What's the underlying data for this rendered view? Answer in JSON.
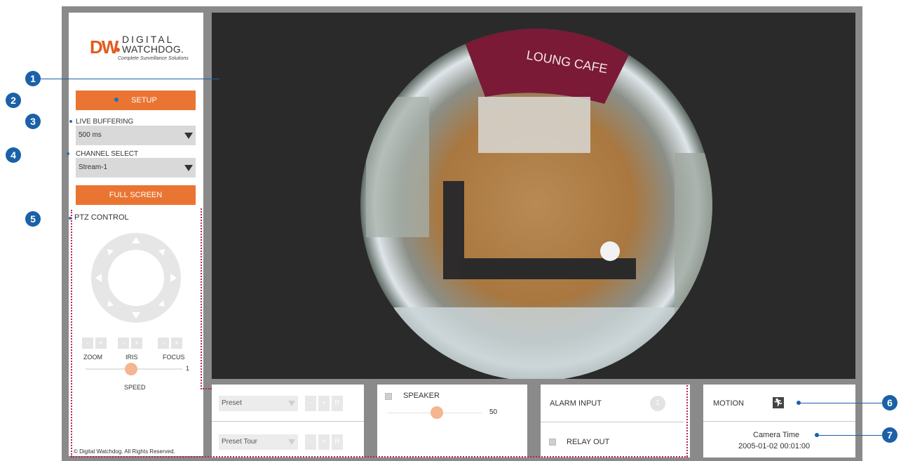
{
  "brand": {
    "logo_mark": "DW",
    "name_line1": "DIGITAL",
    "name_line2": "WATCHDOG.",
    "tagline": "Complete Surveillance Solutions"
  },
  "sidebar": {
    "setup_label": "SETUP",
    "live_buffering": {
      "label": "LIVE BUFFERING",
      "value": "500 ms"
    },
    "channel_select": {
      "label": "CHANNEL SELECT",
      "value": "Stream-1"
    },
    "fullscreen_label": "FULL SCREEN",
    "ptz": {
      "title": "PTZ CONTROL",
      "minus": "-",
      "plus": "+",
      "zoom_label": "ZOOM",
      "iris_label": "IRIS",
      "focus_label": "FOCUS",
      "speed_label": "SPEED",
      "speed_value": "1",
      "speed_fraction": 0.45
    },
    "copyright": "© Digital Watchdog. All Rights Reserved."
  },
  "video": {
    "overlay_text": "LOUNG CAFE"
  },
  "preset_panel": {
    "preset": {
      "value": "Preset",
      "minus": "-",
      "plus": "+",
      "r": "R"
    },
    "preset_tour": {
      "value": "Preset Tour",
      "minus": "-",
      "plus": "+",
      "r": "R"
    }
  },
  "speaker_panel": {
    "label": "SPEAKER",
    "volume_value": "50",
    "volume_fraction": 0.5
  },
  "alarm_panel": {
    "alarm_input_label": "ALARM INPUT",
    "alarm_input_number": "1",
    "relay_out_label": "RELAY OUT"
  },
  "status_panel": {
    "motion_label": "MOTION",
    "camera_time_label": "Camera Time",
    "camera_time_value": "2005-01-02 00:01:00"
  },
  "callouts": [
    "1",
    "2",
    "3",
    "4",
    "5",
    "6",
    "7"
  ],
  "colors": {
    "accent_orange": "#ea7532",
    "callout_blue": "#1a61a8",
    "frame_grey": "#8a8a8a",
    "dotted_border": "#b3245a"
  }
}
